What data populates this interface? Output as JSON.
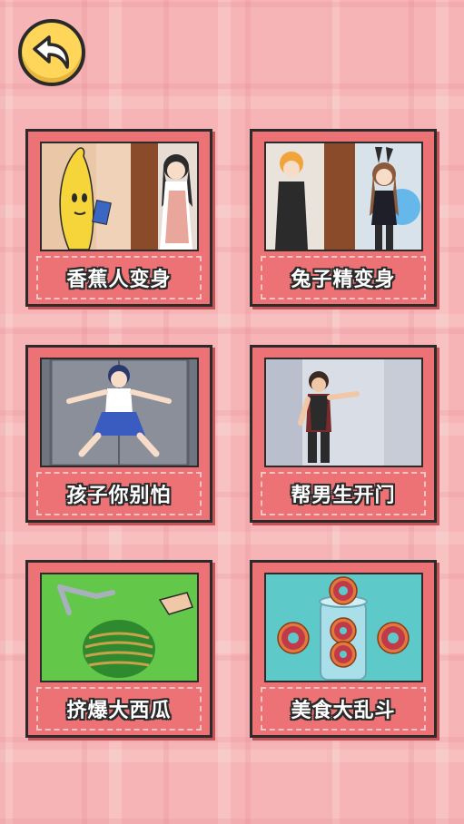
{
  "header": {
    "back_icon": "back-arrow-icon"
  },
  "levels": [
    {
      "title": "香蕉人变身",
      "scene": "banana-man-and-girl"
    },
    {
      "title": "兔子精变身",
      "scene": "bunny-girl-and-boy"
    },
    {
      "title": "孩子你别怕",
      "scene": "girl-in-elevator"
    },
    {
      "title": "帮男生开门",
      "scene": "boy-in-room"
    },
    {
      "title": "挤爆大西瓜",
      "scene": "watermelon-rubber-bands"
    },
    {
      "title": "美食大乱斗",
      "scene": "donuts-in-jar"
    }
  ],
  "colors": {
    "background": "#f6b4b6",
    "card": "#ec7275",
    "back_button": "#ffd65a"
  }
}
